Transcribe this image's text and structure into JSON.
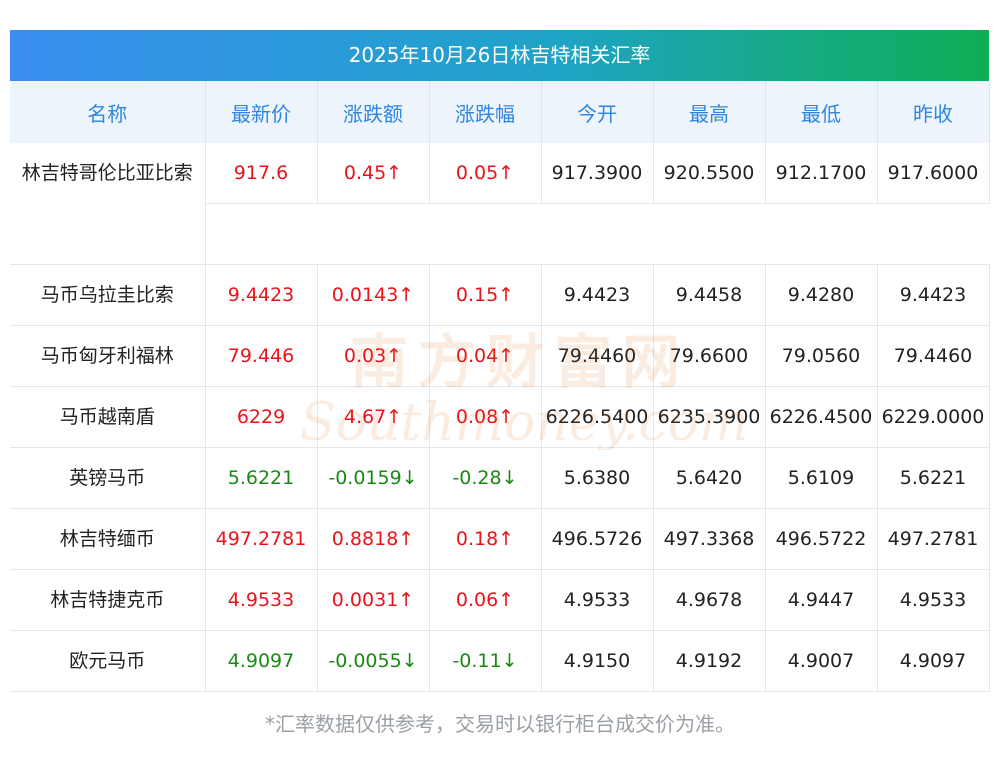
{
  "title": "2025年10月26日林吉特相关汇率",
  "headers": [
    "名称",
    "最新价",
    "涨跌额",
    "涨跌幅",
    "今开",
    "最高",
    "最低",
    "昨收"
  ],
  "rows": [
    {
      "name": "林吉特哥伦比亚比索",
      "latest": "917.6",
      "change": "0.45↑",
      "pct": "0.05↑",
      "open": "917.3900",
      "high": "920.5500",
      "low": "912.1700",
      "prev": "917.6000",
      "dir": "up"
    },
    {
      "name": "马币乌拉圭比索",
      "latest": "9.4423",
      "change": "0.0143↑",
      "pct": "0.15↑",
      "open": "9.4423",
      "high": "9.4458",
      "low": "9.4280",
      "prev": "9.4423",
      "dir": "up"
    },
    {
      "name": "马币匈牙利福林",
      "latest": "79.446",
      "change": "0.03↑",
      "pct": "0.04↑",
      "open": "79.4460",
      "high": "79.6600",
      "low": "79.0560",
      "prev": "79.4460",
      "dir": "up"
    },
    {
      "name": "马币越南盾",
      "latest": "6229",
      "change": "4.67↑",
      "pct": "0.08↑",
      "open": "6226.5400",
      "high": "6235.3900",
      "low": "6226.4500",
      "prev": "6229.0000",
      "dir": "up"
    },
    {
      "name": "英镑马币",
      "latest": "5.6221",
      "change": "-0.0159↓",
      "pct": "-0.28↓",
      "open": "5.6380",
      "high": "5.6420",
      "low": "5.6109",
      "prev": "5.6221",
      "dir": "down"
    },
    {
      "name": "林吉特缅币",
      "latest": "497.2781",
      "change": "0.8818↑",
      "pct": "0.18↑",
      "open": "496.5726",
      "high": "497.3368",
      "low": "496.5722",
      "prev": "497.2781",
      "dir": "up"
    },
    {
      "name": "林吉特捷克币",
      "latest": "4.9533",
      "change": "0.0031↑",
      "pct": "0.06↑",
      "open": "4.9533",
      "high": "4.9678",
      "low": "4.9447",
      "prev": "4.9533",
      "dir": "up"
    },
    {
      "name": "欧元马币",
      "latest": "4.9097",
      "change": "-0.0055↓",
      "pct": "-0.11↓",
      "open": "4.9150",
      "high": "4.9192",
      "low": "4.9007",
      "prev": "4.9097",
      "dir": "down"
    }
  ],
  "watermark": {
    "cn": "南方财富网",
    "en": "Southmoney.com"
  },
  "footer": "*汇率数据仅供参考，交易时以银行柜台成交价为准。",
  "colors": {
    "up": "#e8141a",
    "down": "#1a8a14",
    "header_text": "#2f86e0",
    "title_start": "#3a8ef0",
    "title_end": "#0fae52"
  }
}
